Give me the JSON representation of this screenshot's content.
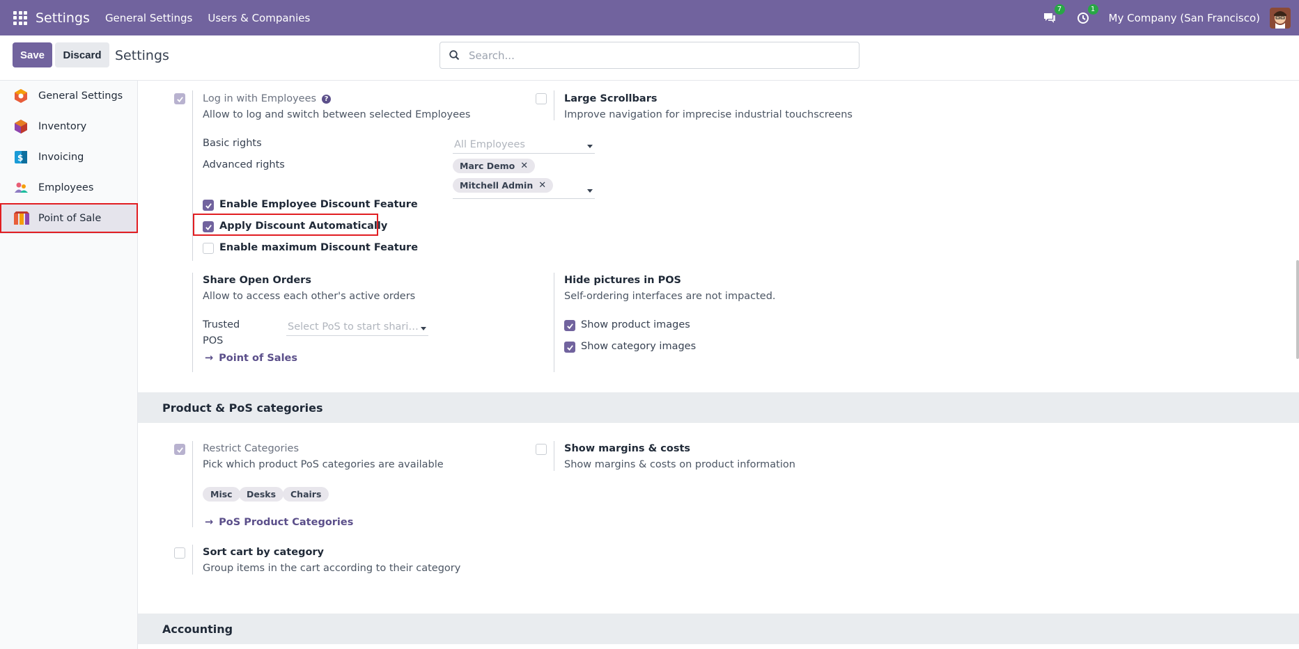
{
  "navbar": {
    "app_name": "Settings",
    "menu": [
      "General Settings",
      "Users & Companies"
    ],
    "messages_badge": "7",
    "activities_badge": "1",
    "company": "My Company (San Francisco)",
    "accent_color": "#71639e"
  },
  "control_panel": {
    "save_label": "Save",
    "discard_label": "Discard",
    "title": "Settings",
    "search_placeholder": "Search..."
  },
  "sidebar": {
    "items": [
      {
        "label": "General Settings",
        "icon": "odoo-logo-icon"
      },
      {
        "label": "Inventory",
        "icon": "inventory-box-icon"
      },
      {
        "label": "Invoicing",
        "icon": "invoice-dollar-icon"
      },
      {
        "label": "Employees",
        "icon": "employees-people-icon"
      },
      {
        "label": "Point of Sale",
        "icon": "pos-store-icon",
        "active": true
      }
    ]
  },
  "settings": {
    "login_employees": {
      "title": "Log in with Employees",
      "desc": "Allow to log and switch between selected Employees",
      "checked": true,
      "basic_rights_label": "Basic rights",
      "basic_rights_placeholder": "All Employees",
      "advanced_rights_label": "Advanced rights",
      "advanced_rights_tags": [
        "Marc Demo",
        "Mitchell Admin"
      ],
      "options": [
        {
          "label": "Enable Employee Discount Feature",
          "checked": true
        },
        {
          "label": "Apply Discount Automatically",
          "checked": true
        },
        {
          "label": "Enable maximum Discount Feature",
          "checked": false
        }
      ]
    },
    "large_scrollbars": {
      "title": "Large Scrollbars",
      "desc": "Improve navigation for imprecise industrial touchscreens",
      "checked": false
    },
    "share_open_orders": {
      "title": "Share Open Orders",
      "desc": "Allow to access each other's active orders",
      "trusted_label_1": "Trusted",
      "trusted_label_2": "POS",
      "trusted_placeholder": "Select PoS to start shari…",
      "link": "Point of Sales"
    },
    "hide_pictures": {
      "title": "Hide pictures in POS",
      "desc": "Self-ordering interfaces are not impacted.",
      "options": [
        {
          "label": "Show product images",
          "checked": true
        },
        {
          "label": "Show category images",
          "checked": true
        }
      ]
    },
    "section_categories": "Product & PoS categories",
    "restrict_categories": {
      "title": "Restrict Categories",
      "desc": "Pick which product PoS categories are available",
      "checked": true,
      "tags": [
        "Misc",
        "Desks",
        "Chairs"
      ],
      "link": "PoS Product Categories"
    },
    "show_margins": {
      "title": "Show margins & costs",
      "desc": "Show margins & costs on product information",
      "checked": false
    },
    "sort_cart": {
      "title": "Sort cart by category",
      "desc": "Group items in the cart according to their category",
      "checked": false
    },
    "section_accounting": "Accounting"
  }
}
